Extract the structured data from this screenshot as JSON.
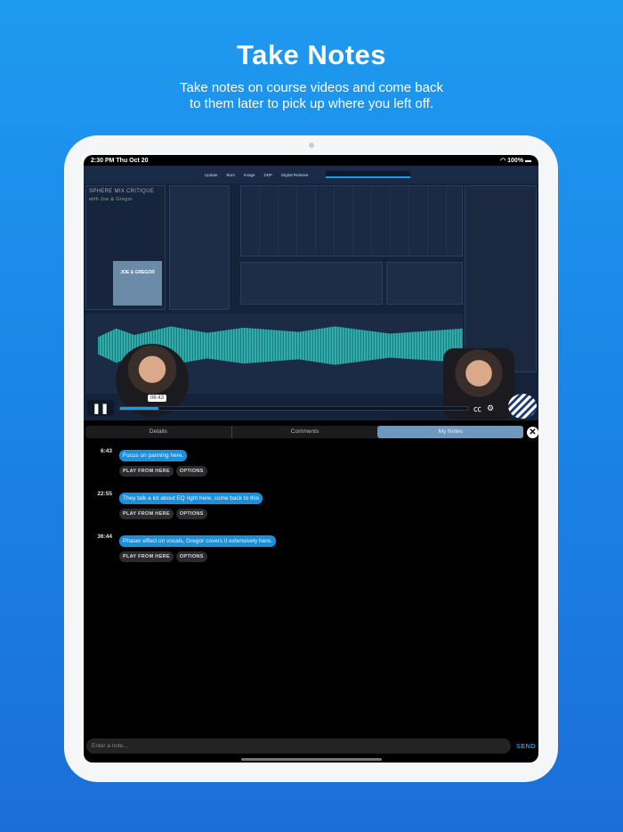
{
  "hero": {
    "title": "Take Notes",
    "subtitle_line1": "Take notes on course videos and come back",
    "subtitle_line2": "to them later to pick up where you left off."
  },
  "status_bar": {
    "time": "2:30 PM  Thu Oct 20",
    "battery": "100%"
  },
  "video": {
    "toolbar": [
      "Update",
      "Burn",
      "Image",
      "DDP",
      "Digital Release"
    ],
    "course_title": "SPHERE MIX CRITIQUE",
    "course_subtitle": "with Joe & Gregor",
    "album_art_text": "JOE & GREGOR",
    "progress_percent": 11,
    "tooltip_time": "06:43"
  },
  "tabs": [
    {
      "label": "Details"
    },
    {
      "label": "Comments"
    },
    {
      "label": "My Notes",
      "active": true
    }
  ],
  "notes": [
    {
      "time": "6:43",
      "text": "Focus on panning here.",
      "play_label": "PLAY FROM HERE",
      "options_label": "OPTIONS"
    },
    {
      "time": "22:55",
      "text": "They talk a lot about EQ right here, come back to this",
      "play_label": "PLAY FROM HERE",
      "options_label": "OPTIONS"
    },
    {
      "time": "36:44",
      "text": "Phaser effect on vocals, Gregor covers it extensively here.",
      "play_label": "PLAY FROM HERE",
      "options_label": "OPTIONS"
    }
  ],
  "input": {
    "placeholder": "Enter a note...",
    "send_label": "SEND"
  },
  "colors": {
    "accent": "#1b8fd9",
    "active_tab": "#6e98bd",
    "background": "#1e9af0"
  }
}
